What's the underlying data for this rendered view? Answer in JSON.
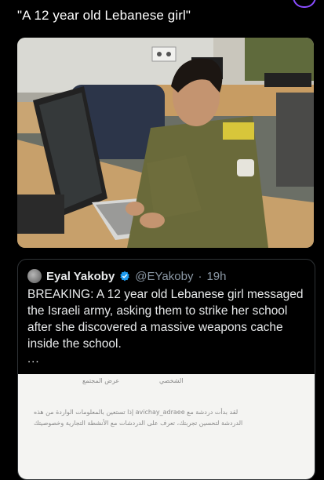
{
  "caption": "\"A 12 year old Lebanese girl\"",
  "quoted_post": {
    "author_name": "Eyal Yakoby",
    "handle": "@EYakoby",
    "separator": "·",
    "time": "19h",
    "text": "BREAKING: A 12 year old Lebanese girl messaged the Israeli army, asking them to strike her school after she discovered a massive weapons cache inside the school.",
    "more": "...",
    "image_text": {
      "line1": "عرض المجتمع",
      "line2": "الشخصي",
      "line3": "لقد بدأت دردشة مع avichay_adraee إذا تستعين بالمعلومات الواردة من هذه",
      "line4": "الدردشة لتحسين تجربتك، تعرف على الدردشات مع الأنشطة التجارية وخصوصيتك"
    }
  },
  "colors": {
    "background": "#000000",
    "verified_badge": "#1d9bf0",
    "muted_text": "#8b98a5"
  },
  "icons": {
    "verified": "verified-badge-icon",
    "avatar": "avatar"
  }
}
